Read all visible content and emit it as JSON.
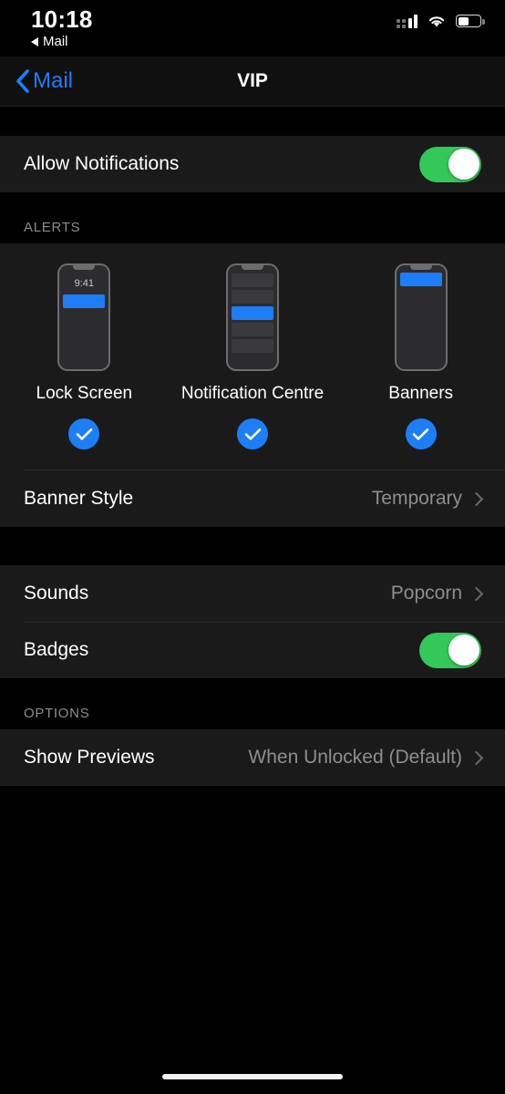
{
  "status_bar": {
    "time": "10:18",
    "return_app": "Mail",
    "signal_icon": "cellular-signal-icon",
    "wifi_icon": "wifi-icon",
    "battery_icon": "battery-icon"
  },
  "nav": {
    "back_label": "Mail",
    "title": "VIP"
  },
  "notifications": {
    "allow_label": "Allow Notifications",
    "allow_enabled": true
  },
  "alerts": {
    "header": "ALERTS",
    "options": [
      {
        "label": "Lock Screen",
        "preview_time": "9:41",
        "selected": true
      },
      {
        "label": "Notification Centre",
        "preview_time": "",
        "selected": true
      },
      {
        "label": "Banners",
        "preview_time": "",
        "selected": true
      }
    ],
    "banner_style": {
      "label": "Banner Style",
      "value": "Temporary"
    }
  },
  "sounds_group": {
    "sounds": {
      "label": "Sounds",
      "value": "Popcorn"
    },
    "badges": {
      "label": "Badges",
      "enabled": true
    }
  },
  "options": {
    "header": "OPTIONS",
    "show_previews": {
      "label": "Show Previews",
      "value": "When Unlocked (Default)"
    }
  },
  "colors": {
    "accent_blue": "#1d7ef7",
    "toggle_green": "#34c759",
    "cell_bg": "#1a1a1a",
    "page_bg": "#000000",
    "secondary_text": "#8d8d92"
  }
}
